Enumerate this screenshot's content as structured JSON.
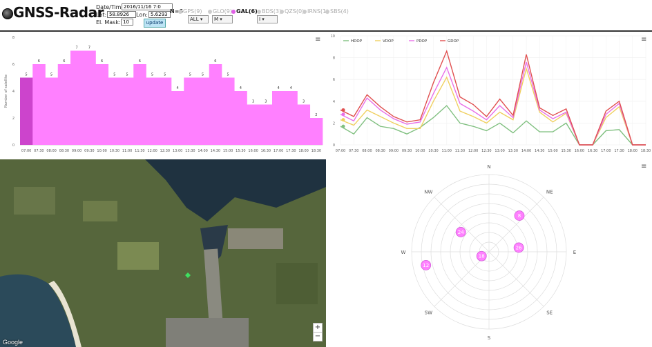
{
  "app": {
    "title": "GNSS-Radar"
  },
  "form": {
    "datetime_label": "Date/Time:",
    "datetime_value": "2016/11/16 7:0",
    "lat_label": "Lat:",
    "lat_value": "58.8926",
    "lon_label": "Lon:",
    "lon_value": "5.6293",
    "mask_label": "El. Mask:",
    "mask_value": "10",
    "update_label": "update"
  },
  "n_sats": "N=6",
  "constellations": [
    {
      "label": "GPS(9)",
      "active": false
    },
    {
      "label": "GLO(9)",
      "active": false
    },
    {
      "label": "GAL(6)",
      "active": true
    },
    {
      "label": "BDS(3)",
      "active": false
    },
    {
      "label": "QZS(0)",
      "active": false
    },
    {
      "label": "IRNS(1)",
      "active": false
    },
    {
      "label": "SBS(4)",
      "active": false
    }
  ],
  "selects": {
    "gps": "ALL",
    "glo": "M",
    "bds": "I"
  },
  "menu_icon": "≡",
  "colors": {
    "gal": "#ff80ff",
    "gal_dark": "#cc44cc",
    "hdop": "#80c080",
    "vdop": "#f0d060",
    "pdop": "#e870e8",
    "gdop": "#e05050"
  },
  "chart_data": [
    {
      "type": "bar",
      "ylabel": "Number of satellite",
      "ylim": [
        0,
        8
      ],
      "yticks": [
        0,
        2,
        4,
        6,
        8
      ],
      "categories": [
        "07:00",
        "07:30",
        "08:00",
        "08:30",
        "09:00",
        "09:30",
        "10:00",
        "10:30",
        "11:00",
        "11:30",
        "12:00",
        "12:30",
        "13:00",
        "13:30",
        "14:00",
        "14:30",
        "15:00",
        "15:30",
        "16:00",
        "16:30",
        "17:00",
        "17:30",
        "18:00",
        "18:30"
      ],
      "values": [
        5,
        6,
        5,
        6,
        7,
        7,
        6,
        5,
        5,
        6,
        5,
        5,
        4,
        5,
        5,
        6,
        5,
        4,
        3,
        3,
        4,
        4,
        3,
        2
      ],
      "highlight_index": 0
    },
    {
      "type": "line",
      "ylim": [
        0,
        10
      ],
      "yticks": [
        0,
        2,
        4,
        6,
        8,
        10
      ],
      "categories": [
        "07:00",
        "07:30",
        "08:00",
        "08:30",
        "09:00",
        "09:30",
        "10:00",
        "10:30",
        "11:00",
        "11:30",
        "12:00",
        "12:30",
        "13:00",
        "13:30",
        "14:00",
        "14:30",
        "15:00",
        "15:30",
        "16:00",
        "16:30",
        "17:00",
        "17:30",
        "18:00",
        "18:30"
      ],
      "series": [
        {
          "name": "HDOP",
          "values": [
            1.7,
            1.0,
            2.5,
            1.7,
            1.5,
            1.0,
            1.6,
            2.5,
            3.6,
            2.0,
            1.7,
            1.3,
            2.0,
            1.1,
            2.2,
            1.2,
            1.2,
            2.0,
            0,
            0,
            1.3,
            1.4,
            0,
            0
          ]
        },
        {
          "name": "VDOP",
          "values": [
            2.3,
            1.8,
            3.2,
            2.6,
            2.0,
            1.5,
            1.5,
            4.0,
            6.2,
            3.1,
            2.6,
            2.0,
            3.0,
            2.3,
            7.0,
            3.0,
            2.1,
            2.9,
            0,
            0,
            2.5,
            3.5,
            0,
            0
          ]
        },
        {
          "name": "PDOP",
          "values": [
            2.8,
            2.2,
            4.3,
            3.2,
            2.4,
            1.9,
            2.1,
            4.7,
            7.1,
            3.8,
            3.1,
            2.3,
            3.6,
            2.5,
            7.6,
            3.2,
            2.4,
            3.0,
            0,
            0,
            2.8,
            3.8,
            0,
            0
          ]
        },
        {
          "name": "GDOP",
          "values": [
            3.2,
            2.6,
            4.6,
            3.5,
            2.6,
            2.1,
            2.3,
            5.7,
            8.6,
            4.4,
            3.7,
            2.6,
            4.2,
            2.7,
            8.3,
            3.4,
            2.7,
            3.3,
            0,
            0,
            3.1,
            4.0,
            0,
            0
          ]
        }
      ]
    },
    {
      "type": "scatter",
      "subtype": "skyplot",
      "directions": [
        "N",
        "NE",
        "E",
        "SE",
        "S",
        "SW",
        "W",
        "NW"
      ],
      "satellites": [
        {
          "id": "8",
          "azimuth": 40,
          "elevation": 35
        },
        {
          "id": "24",
          "azimuth": 305,
          "elevation": 50
        },
        {
          "id": "26",
          "azimuth": 82,
          "elevation": 55
        },
        {
          "id": "18",
          "azimuth": 240,
          "elevation": 80
        },
        {
          "id": "12",
          "azimuth": 258,
          "elevation": 15
        }
      ]
    }
  ],
  "map": {
    "attribution": "Google",
    "zoom_in": "+",
    "zoom_out": "−"
  }
}
